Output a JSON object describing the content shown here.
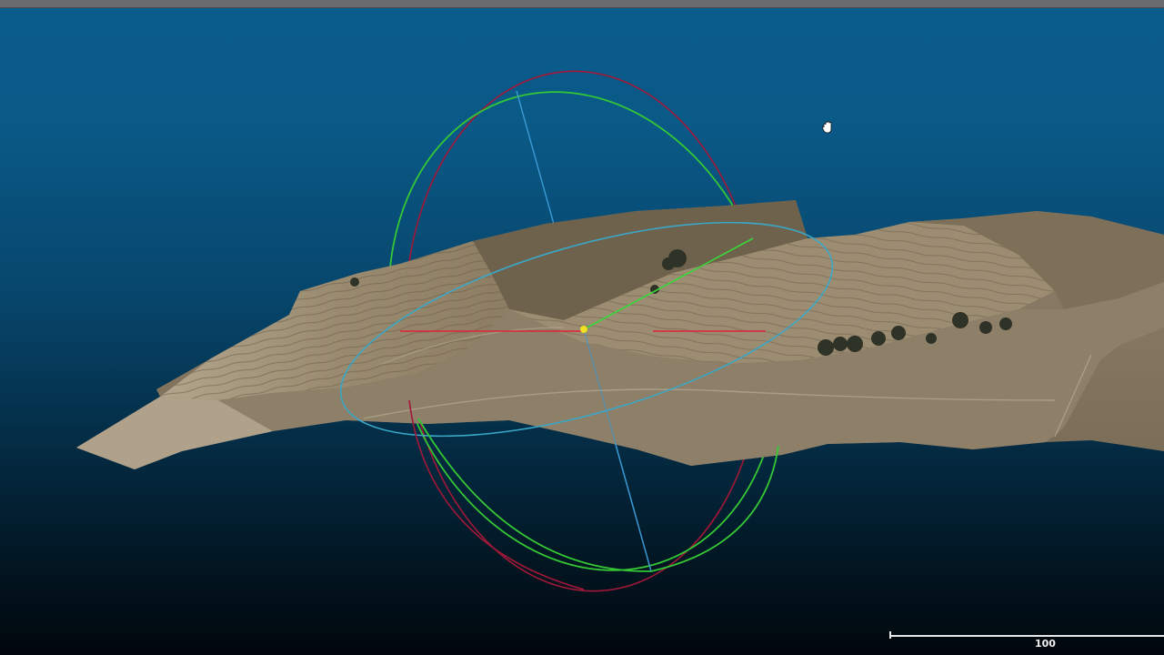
{
  "viewer": {
    "scale_bar": {
      "label": "100"
    },
    "cursor": {
      "icon": "hand-pan-icon"
    },
    "colors": {
      "background_top": "#0a5c8c",
      "background_bottom": "#01070c",
      "gizmo_x": "#e0243a",
      "gizmo_y": "#39d63a",
      "gizmo_z": "#3a9ad6",
      "gizmo_x_ring": "#a01838",
      "gizmo_y_ring": "#35c735",
      "gizmo_z_ring": "#3aa7c7",
      "pivot": "#f0e020",
      "terrain_light": "#a89a80",
      "terrain_dark": "#6d604c"
    }
  }
}
